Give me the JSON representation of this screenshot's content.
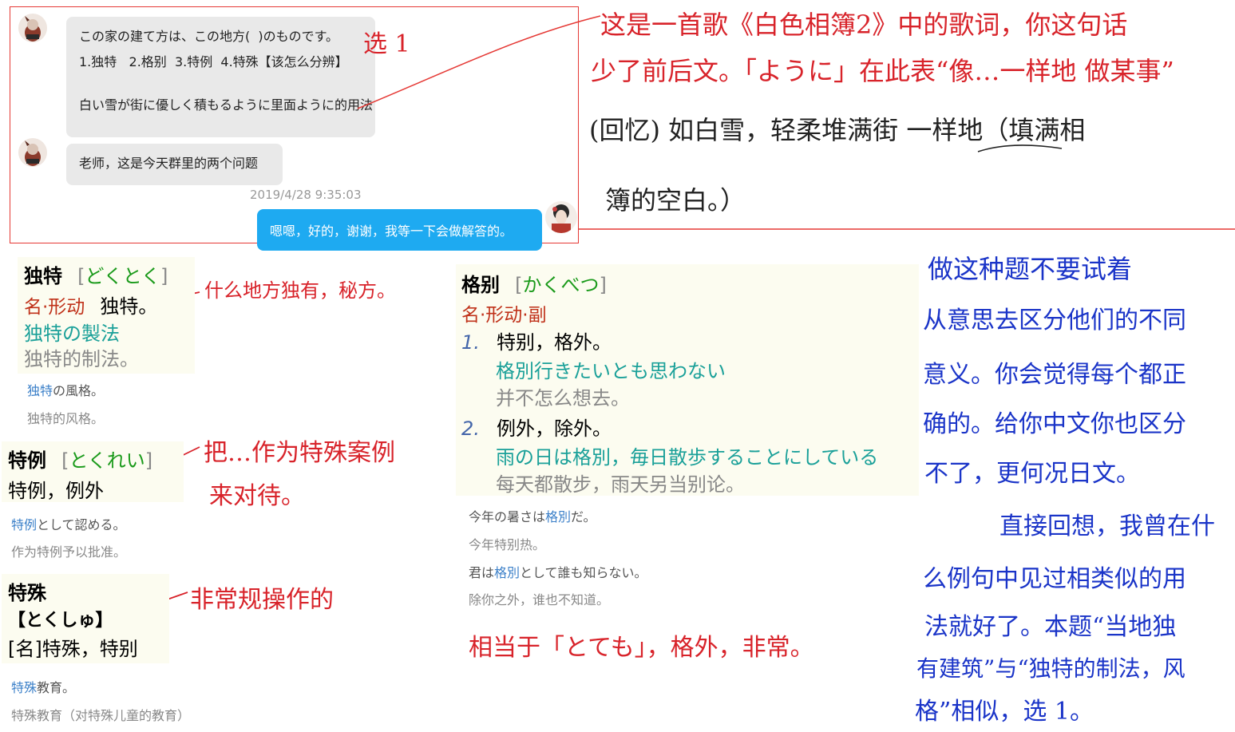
{
  "chat": {
    "message1": {
      "line1": "この家の建て方は、この地方(  )のものです。",
      "line2": "1.独特   2.格别  3.特例  4.特殊【该怎么分辨】",
      "line3": "白い雪が街に優しく積もるように里面ように的用法"
    },
    "message2": "老师，这是今天群里的两个问题",
    "timestamp": "2019/4/28 9:35:03",
    "reply": "嗯嗯，好的，谢谢，我等一下会做解答的。"
  },
  "dictionary": {
    "dokutoku": {
      "word": "独特",
      "reading": "どくとく",
      "pos": "名·形动",
      "meaning": "独特。",
      "ex_jp": "独特の製法",
      "ex_cn": "独特的制法。",
      "small_jp_hl": "独特",
      "small_jp_rest": "の風格。",
      "small_cn": "独特的风格。"
    },
    "tokurei": {
      "word": "特例",
      "reading": "とくれい",
      "meaning_a": "特例",
      "meaning_b": "，例外",
      "small_jp_hl": "特例",
      "small_jp_rest": "として認める。",
      "small_cn": "作为特例予以批准。"
    },
    "tokushu": {
      "word": "特殊",
      "reading": "【とくしゅ】",
      "pos_tag": "[名]",
      "meaning_a": "特殊",
      "meaning_b": "，特别",
      "small_jp_hl": "特殊",
      "small_jp_rest": "教育。",
      "small_cn": "特殊教育（对特殊儿童的教育）"
    },
    "kakubetsu": {
      "word": "格别",
      "reading": "かくべつ",
      "pos": "名·形动·副",
      "sense1_num": "1.",
      "sense1": "特别，格外。",
      "sense1_ex_jp": "格別行きたいとも思わない",
      "sense1_ex_cn": "并不怎么想去。",
      "sense2_num": "2.",
      "sense2": "例外，除外。",
      "sense2_ex_jp": "雨の日は格別，毎日散歩することにしている",
      "sense2_ex_cn": "每天都散步，雨天另当别论。",
      "small1_jp_a": "今年の暑さは",
      "small1_jp_hl": "格別",
      "small1_jp_b": "だ。",
      "small1_cn": "今年特别热。",
      "small2_jp_a": "君は",
      "small2_jp_hl": "格別",
      "small2_jp_b": "として誰も知らない。",
      "small2_cn": "除你之外，谁也不知道。"
    }
  },
  "annotations": {
    "choose": "选 1",
    "song_note_1": "这是一首歌《白色相簿2》中的歌词，你这句话",
    "song_note_2": "少了前后文。「ように」在此表“像…一样地 做某事”",
    "song_note_3": "(回忆) 如白雪，轻柔堆满街  一样地（填满相",
    "song_note_4": "簿的空白。）",
    "dokutoku_note": "什么地方独有，秘方。",
    "tokurei_note_1": "把…作为特殊案例",
    "tokurei_note_2": "来对待。",
    "tokushu_note": "非常规操作的",
    "kakubetsu_note": "相当于「とても」，格外，非常。",
    "blue_1": "做这种题不要试着",
    "blue_2": "从意思去区分他们的不同",
    "blue_3": "意义。你会觉得每个都正",
    "blue_4": "确的。给你中文你也区分",
    "blue_5": "不了，更何况日文。",
    "blue_6": "直接回想，我曾在什",
    "blue_7": "么例句中见过相类似的用",
    "blue_8": "法就好了。本题“当地独",
    "blue_9": "有建筑”与“独特的制法，风",
    "blue_10": "格”相似，选 1。"
  },
  "colors": {
    "frame": "#e53935",
    "reply_bubble": "#1eaaf1",
    "pen_red": "#d8232a",
    "pen_blue": "#1a34c8"
  }
}
